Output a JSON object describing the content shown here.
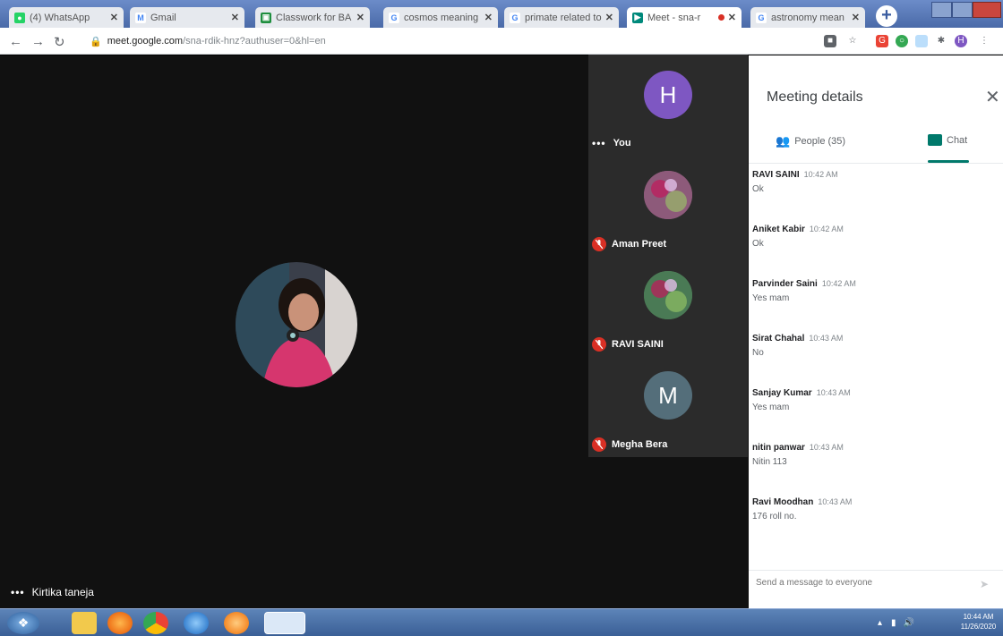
{
  "browser": {
    "tabs": [
      {
        "title": "(4) WhatsApp",
        "favicon_color": "#25d366",
        "favicon_glyph": "●",
        "active": false
      },
      {
        "title": "Gmail",
        "favicon_color": "#ffffff",
        "favicon_glyph": "M",
        "active": false
      },
      {
        "title": "Classwork for BA",
        "favicon_color": "#1e8e3e",
        "favicon_glyph": "▣",
        "active": false
      },
      {
        "title": "cosmos meaning",
        "favicon_color": "#ffffff",
        "favicon_glyph": "G",
        "active": false
      },
      {
        "title": "primate related to",
        "favicon_color": "#ffffff",
        "favicon_glyph": "G",
        "active": false
      },
      {
        "title": "Meet - sna-r",
        "favicon_color": "#00897b",
        "favicon_glyph": "▶",
        "active": true
      },
      {
        "title": "astronomy mean",
        "favicon_color": "#ffffff",
        "favicon_glyph": "G",
        "active": false
      }
    ],
    "url_host": "meet.google.com",
    "url_path": "/sna-rdik-hnz?authuser=0&hl=en"
  },
  "meet": {
    "main_participant_name": "Kirtika taneja",
    "tiles": [
      {
        "name": "You",
        "initial": "H",
        "avatar_color": "#7e57c2",
        "muted": false,
        "has_photo": false
      },
      {
        "name": "Aman Preet",
        "initial": "",
        "avatar_color": "#8d5a7a",
        "muted": true,
        "has_photo": true
      },
      {
        "name": "RAVI SAINI",
        "initial": "",
        "avatar_color": "#4a7a55",
        "muted": true,
        "has_photo": true
      },
      {
        "name": "Megha Bera",
        "initial": "M",
        "avatar_color": "#546e7a",
        "muted": true,
        "has_photo": false
      }
    ]
  },
  "panel": {
    "title": "Meeting details",
    "people_tab": "People (35)",
    "chat_tab": "Chat",
    "messages": [
      {
        "sender": "RAVI SAINI",
        "time": "10:42 AM",
        "text": "Ok"
      },
      {
        "sender": "Aniket Kabir",
        "time": "10:42 AM",
        "text": "Ok"
      },
      {
        "sender": "Parvinder Saini",
        "time": "10:42 AM",
        "text": "Yes mam"
      },
      {
        "sender": "Sirat Chahal",
        "time": "10:43 AM",
        "text": "No"
      },
      {
        "sender": "Sanjay Kumar",
        "time": "10:43 AM",
        "text": "Yes mam"
      },
      {
        "sender": "nitin panwar",
        "time": "10:43 AM",
        "text": "Nitin 113"
      },
      {
        "sender": "Ravi Moodhan",
        "time": "10:43 AM",
        "text": "176 roll no."
      }
    ],
    "composer_placeholder": "Send a message to everyone"
  },
  "taskbar": {
    "time": "10:44 AM",
    "date": "11/26/2020"
  },
  "colors": {
    "meet_stage": "#111111",
    "chat_accent": "#00796b",
    "muted_red": "#d93025"
  }
}
